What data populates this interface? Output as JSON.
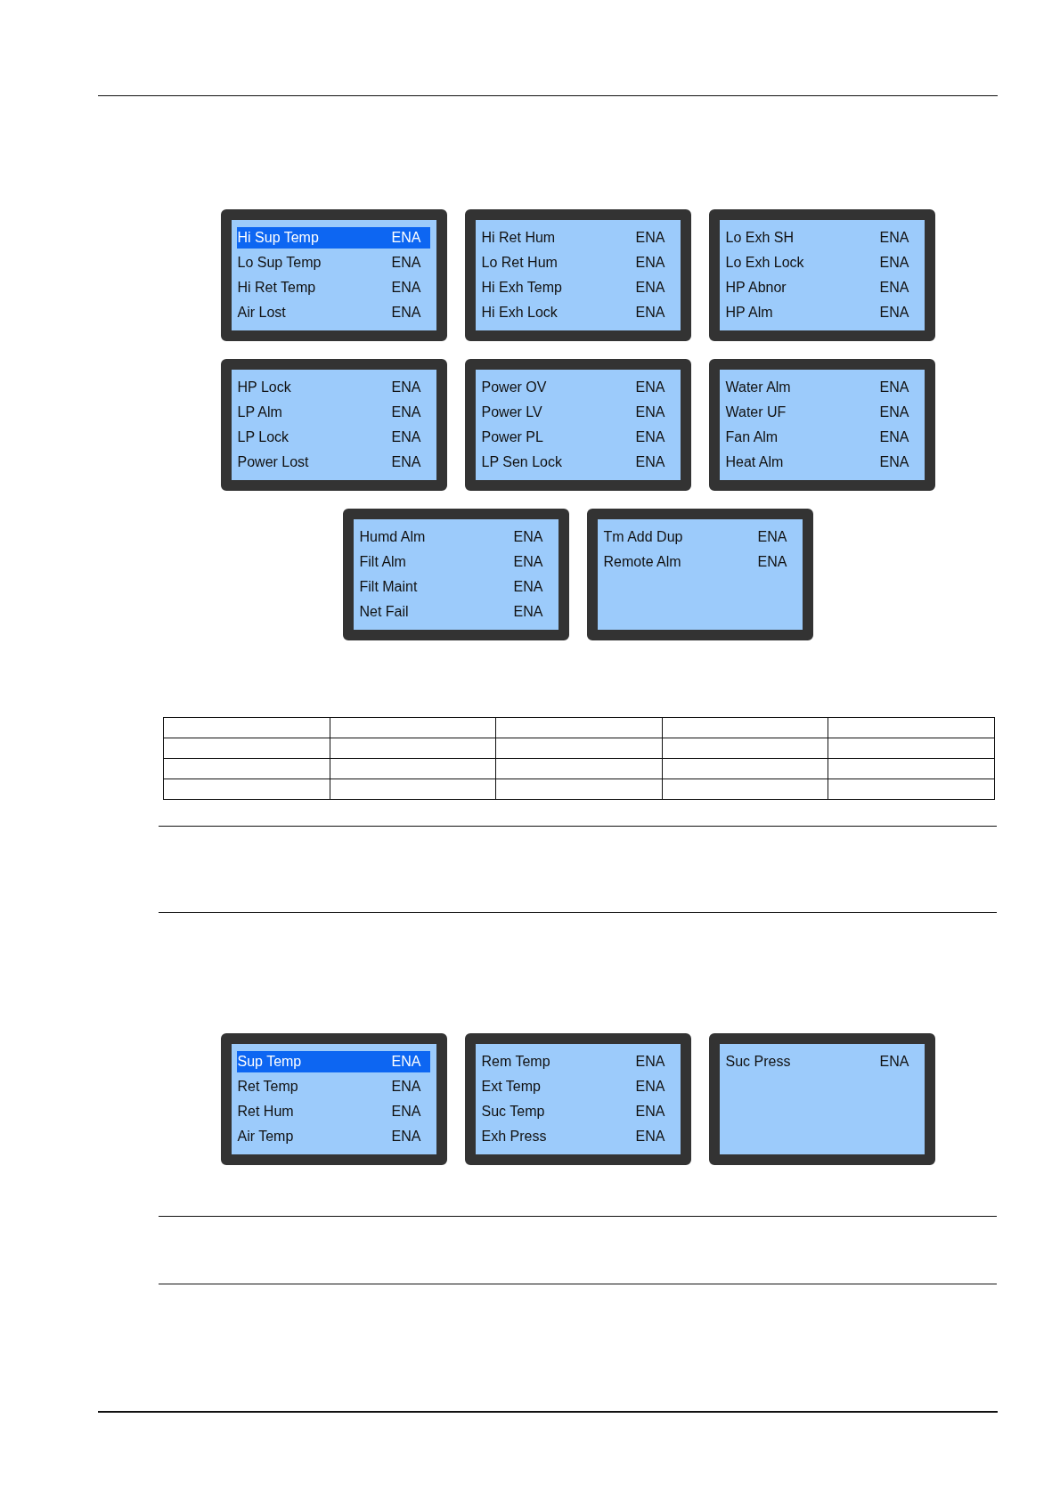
{
  "figure_1": {
    "screen_rows": [
      {
        "screens": [
          {
            "items": [
              {
                "label": "Hi Sup Temp",
                "value": "ENA",
                "selected": true
              },
              {
                "label": "Lo Sup Temp",
                "value": "ENA",
                "selected": false
              },
              {
                "label": "Hi Ret Temp",
                "value": "ENA",
                "selected": false
              },
              {
                "label": "Air Lost",
                "value": "ENA",
                "selected": false
              }
            ]
          },
          {
            "items": [
              {
                "label": "Hi Ret Hum",
                "value": "ENA",
                "selected": false
              },
              {
                "label": "Lo Ret Hum",
                "value": "ENA",
                "selected": false
              },
              {
                "label": "Hi Exh Temp",
                "value": "ENA",
                "selected": false
              },
              {
                "label": "Hi Exh Lock",
                "value": "ENA",
                "selected": false
              }
            ]
          },
          {
            "items": [
              {
                "label": "Lo Exh SH",
                "value": "ENA",
                "selected": false
              },
              {
                "label": "Lo Exh Lock",
                "value": "ENA",
                "selected": false
              },
              {
                "label": "HP Abnor",
                "value": "ENA",
                "selected": false
              },
              {
                "label": "HP Alm",
                "value": "ENA",
                "selected": false
              }
            ]
          }
        ]
      },
      {
        "screens": [
          {
            "items": [
              {
                "label": "HP Lock",
                "value": "ENA",
                "selected": false
              },
              {
                "label": "LP Alm",
                "value": "ENA",
                "selected": false
              },
              {
                "label": "LP Lock",
                "value": "ENA",
                "selected": false
              },
              {
                "label": "Power Lost",
                "value": "ENA",
                "selected": false
              }
            ]
          },
          {
            "items": [
              {
                "label": "Power OV",
                "value": "ENA",
                "selected": false
              },
              {
                "label": "Power LV",
                "value": "ENA",
                "selected": false
              },
              {
                "label": "Power PL",
                "value": "ENA",
                "selected": false
              },
              {
                "label": "LP Sen Lock",
                "value": "ENA",
                "selected": false
              }
            ]
          },
          {
            "items": [
              {
                "label": "Water Alm",
                "value": "ENA",
                "selected": false
              },
              {
                "label": "Water UF",
                "value": "ENA",
                "selected": false
              },
              {
                "label": "Fan Alm",
                "value": "ENA",
                "selected": false
              },
              {
                "label": "Heat Alm",
                "value": "ENA",
                "selected": false
              }
            ]
          }
        ]
      },
      {
        "screens": [
          {
            "items": [
              {
                "label": "Humd Alm",
                "value": "ENA",
                "selected": false
              },
              {
                "label": "Filt Alm",
                "value": "ENA",
                "selected": false
              },
              {
                "label": "Filt Maint",
                "value": "ENA",
                "selected": false
              },
              {
                "label": "Net Fail",
                "value": "ENA",
                "selected": false
              }
            ]
          },
          {
            "items": [
              {
                "label": "Tm Add Dup",
                "value": "ENA",
                "selected": false
              },
              {
                "label": "Remote Alm",
                "value": "ENA",
                "selected": false
              }
            ]
          }
        ]
      }
    ]
  },
  "figure_2": {
    "screen_rows": [
      {
        "screens": [
          {
            "items": [
              {
                "label": "Sup Temp",
                "value": "ENA",
                "selected": true
              },
              {
                "label": "Ret Temp",
                "value": "ENA",
                "selected": false
              },
              {
                "label": "Ret Hum",
                "value": "ENA",
                "selected": false
              },
              {
                "label": "Air Temp",
                "value": "ENA",
                "selected": false
              }
            ]
          },
          {
            "items": [
              {
                "label": "Rem Temp",
                "value": "ENA",
                "selected": false
              },
              {
                "label": "Ext Temp",
                "value": "ENA",
                "selected": false
              },
              {
                "label": "Suc Temp",
                "value": "ENA",
                "selected": false
              },
              {
                "label": "Exh Press",
                "value": "ENA",
                "selected": false
              }
            ]
          },
          {
            "items": [
              {
                "label": "Suc Press",
                "value": "ENA",
                "selected": false
              }
            ]
          }
        ]
      }
    ]
  }
}
